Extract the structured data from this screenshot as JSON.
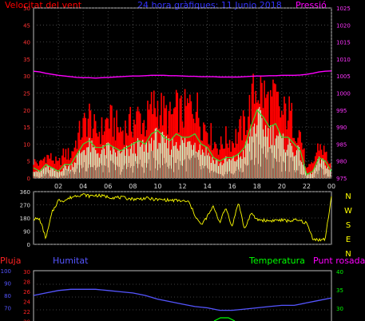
{
  "colors": {
    "wind_speed": "#ff0000",
    "wind_avg": "#33dd33",
    "wind_min": "#ccffcc",
    "pressure": "#ff00ff",
    "direction": "#ffff00",
    "rain": "#ff2222",
    "humidity": "#5555ff",
    "temperature": "#00ff00",
    "dewpoint": "#ff00ff",
    "title": "#3333ff",
    "frame": "#bbbbbb"
  },
  "chart_data": [
    {
      "type": "line",
      "title": "24 hora gràfiques: 11 Junio 2018",
      "left_label": "Velocitat del vent",
      "right_label": "Pressió",
      "ylim_left": [
        0,
        50
      ],
      "ylim_right": [
        975,
        1025
      ],
      "yticks_left": [
        "0",
        "5",
        "10",
        "15",
        "20",
        "25",
        "30",
        "35",
        "40",
        "45",
        "50"
      ],
      "yticks_right": [
        "975",
        "980",
        "985",
        "990",
        "995",
        "1000",
        "1005",
        "1010",
        "1015",
        "1020",
        "1025"
      ],
      "xticks": [
        "02",
        "04",
        "06",
        "08",
        "10",
        "12",
        "14",
        "16",
        "18",
        "20",
        "22",
        "00"
      ],
      "hours": [
        0,
        0.5,
        1,
        1.5,
        2,
        2.5,
        3,
        3.5,
        4,
        4.5,
        5,
        5.5,
        6,
        6.5,
        7,
        7.5,
        8,
        8.5,
        9,
        9.5,
        10,
        10.5,
        11,
        11.5,
        12,
        12.5,
        13,
        13.5,
        14,
        14.5,
        15,
        15.5,
        16,
        16.5,
        17,
        17.5,
        18,
        18.5,
        19,
        19.5,
        20,
        20.5,
        21,
        21.5,
        22,
        22.5,
        23,
        23.5,
        24
      ],
      "series": [
        {
          "name": "gust",
          "values": [
            6,
            5,
            8,
            7,
            5,
            9,
            8,
            14,
            18,
            22,
            16,
            17,
            21,
            19,
            17,
            18,
            20,
            22,
            19,
            25,
            26,
            23,
            21,
            24,
            23,
            25,
            27,
            20,
            18,
            13,
            11,
            14,
            13,
            16,
            19,
            26,
            33,
            30,
            26,
            28,
            22,
            24,
            19,
            16,
            3,
            5,
            12,
            9,
            4
          ]
        },
        {
          "name": "avg",
          "values": [
            3,
            2,
            4,
            3,
            2,
            4,
            4,
            7,
            10,
            11,
            9,
            9,
            10,
            9,
            8,
            9,
            10,
            11,
            10,
            13,
            14,
            12,
            11,
            13,
            12,
            12,
            13,
            10,
            9,
            6,
            5,
            6,
            6,
            7,
            9,
            15,
            20,
            18,
            15,
            16,
            12,
            12,
            10,
            8,
            1,
            2,
            6,
            5,
            2
          ]
        },
        {
          "name": "min",
          "values": [
            1,
            0,
            2,
            1,
            0,
            2,
            2,
            3,
            5,
            6,
            4,
            4,
            5,
            4,
            3,
            4,
            5,
            5,
            4,
            7,
            7,
            6,
            5,
            6,
            6,
            6,
            7,
            4,
            3,
            2,
            1,
            2,
            2,
            3,
            4,
            8,
            12,
            10,
            8,
            9,
            6,
            6,
            5,
            3,
            0,
            0,
            3,
            2,
            0
          ]
        },
        {
          "name": "pressure",
          "values": [
            1006.4,
            1006.2,
            1005.8,
            1005.5,
            1005.2,
            1005.0,
            1004.8,
            1004.6,
            1004.5,
            1004.5,
            1004.4,
            1004.5,
            1004.6,
            1004.7,
            1004.8,
            1004.9,
            1005.0,
            1005.0,
            1005.1,
            1005.2,
            1005.2,
            1005.2,
            1005.1,
            1005.1,
            1005.0,
            1004.9,
            1004.9,
            1004.8,
            1004.8,
            1004.8,
            1004.7,
            1004.7,
            1004.7,
            1004.7,
            1004.8,
            1004.9,
            1005.0,
            1005.0,
            1005.1,
            1005.1,
            1005.2,
            1005.2,
            1005.2,
            1005.3,
            1005.5,
            1005.8,
            1006.2,
            1006.4,
            1006.5
          ]
        }
      ]
    },
    {
      "type": "line",
      "ylim": [
        0,
        360
      ],
      "yticks": [
        "0",
        "90",
        "180",
        "270",
        "360"
      ],
      "compass": [
        "N",
        "W",
        "S",
        "E",
        "N"
      ],
      "hours": [
        0,
        0.5,
        1,
        1.5,
        2,
        2.5,
        3,
        3.5,
        4,
        4.5,
        5,
        5.5,
        6,
        6.5,
        7,
        7.5,
        8,
        8.5,
        9,
        9.5,
        10,
        10.5,
        11,
        11.5,
        12,
        12.5,
        13,
        13.5,
        14,
        14.5,
        15,
        15.5,
        16,
        16.5,
        17,
        17.5,
        18,
        18.5,
        19,
        19.5,
        20,
        20.5,
        21,
        21.5,
        22,
        22.5,
        23,
        23.5,
        24
      ],
      "series": [
        {
          "name": "direction",
          "values": [
            175,
            170,
            40,
            220,
            300,
            300,
            320,
            335,
            340,
            330,
            335,
            330,
            325,
            320,
            320,
            315,
            310,
            310,
            315,
            310,
            305,
            305,
            300,
            300,
            295,
            290,
            200,
            130,
            190,
            260,
            150,
            250,
            120,
            290,
            100,
            210,
            170,
            165,
            160,
            165,
            165,
            160,
            165,
            160,
            145,
            40,
            30,
            35,
            330
          ]
        }
      ]
    },
    {
      "type": "line",
      "labels": {
        "rain": "Pluja",
        "humidity": "Humitat",
        "temperature": "Temperatura",
        "dewpoint": "Punt rosada"
      },
      "yticks_humidity": [
        "100",
        "90",
        "80",
        "70"
      ],
      "yticks_rain": [
        "30",
        "28",
        "26",
        "24",
        "22",
        "20"
      ],
      "yticks_temp": [
        "40",
        "35",
        "30"
      ],
      "hours": [
        0,
        1,
        2,
        3,
        4,
        5,
        6,
        7,
        8,
        9,
        10,
        11,
        12,
        13,
        14,
        15,
        16,
        17,
        18,
        19,
        20,
        21,
        22,
        23,
        24
      ],
      "series": [
        {
          "name": "humidity",
          "values": [
            80,
            82,
            84,
            85,
            85,
            85,
            84,
            83,
            82,
            80,
            77,
            75,
            73,
            71,
            70,
            68,
            68,
            69,
            70,
            71,
            72,
            72,
            74,
            76,
            78
          ]
        }
      ]
    }
  ]
}
